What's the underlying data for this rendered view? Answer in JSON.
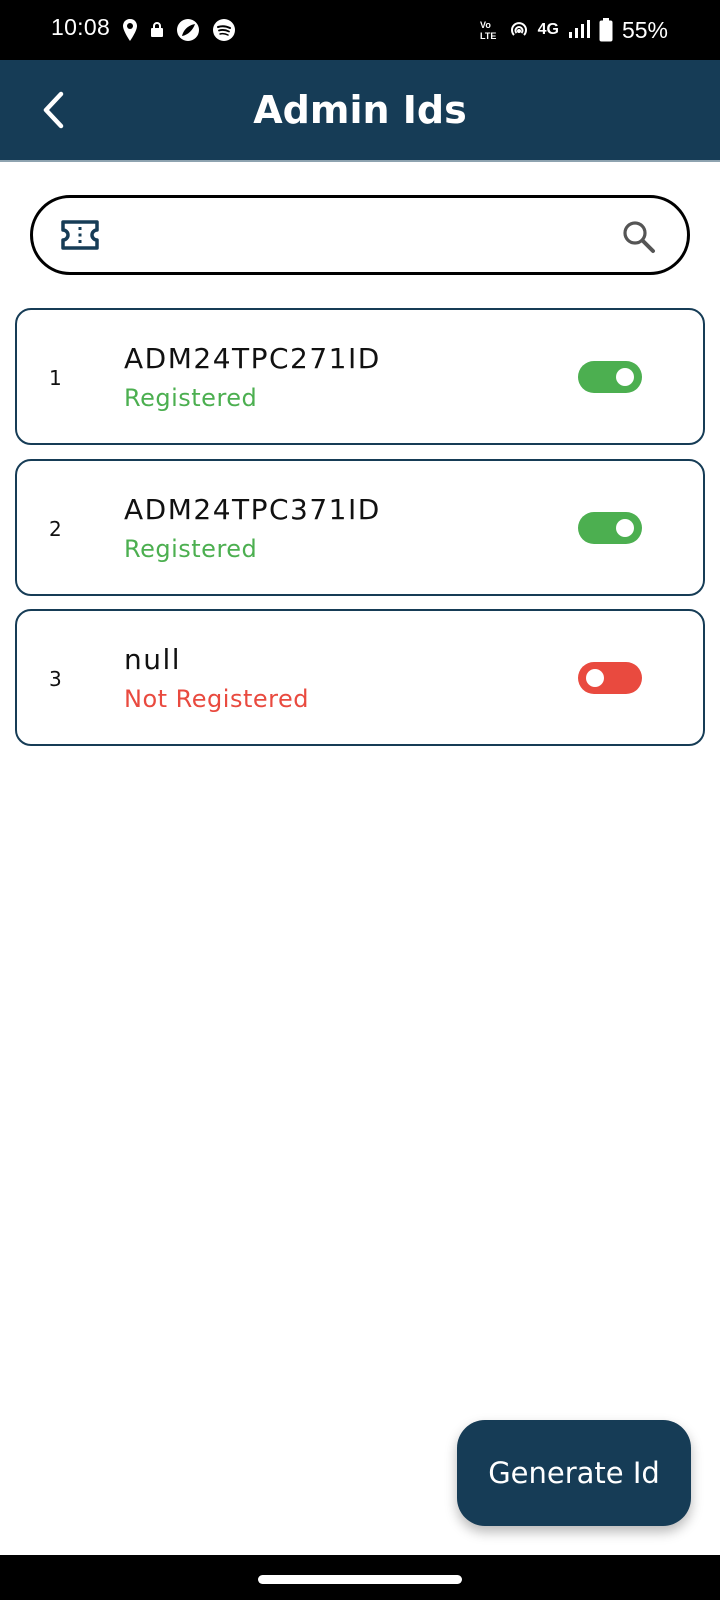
{
  "status_bar": {
    "time": "10:08",
    "network": "4G",
    "battery": "55%"
  },
  "header": {
    "title": "Admin Ids"
  },
  "search": {
    "value": "",
    "placeholder": ""
  },
  "admin_ids": [
    {
      "index": "1",
      "id": "ADM24TPC271ID",
      "status": "Registered",
      "enabled": true
    },
    {
      "index": "2",
      "id": "ADM24TPC371ID",
      "status": "Registered",
      "enabled": true
    },
    {
      "index": "3",
      "id": "null",
      "status": "Not Registered",
      "enabled": false
    }
  ],
  "fab": {
    "label": "Generate Id"
  },
  "colors": {
    "primary": "#163C56",
    "registered": "#4CAF50",
    "not_registered": "#E94A3F"
  }
}
